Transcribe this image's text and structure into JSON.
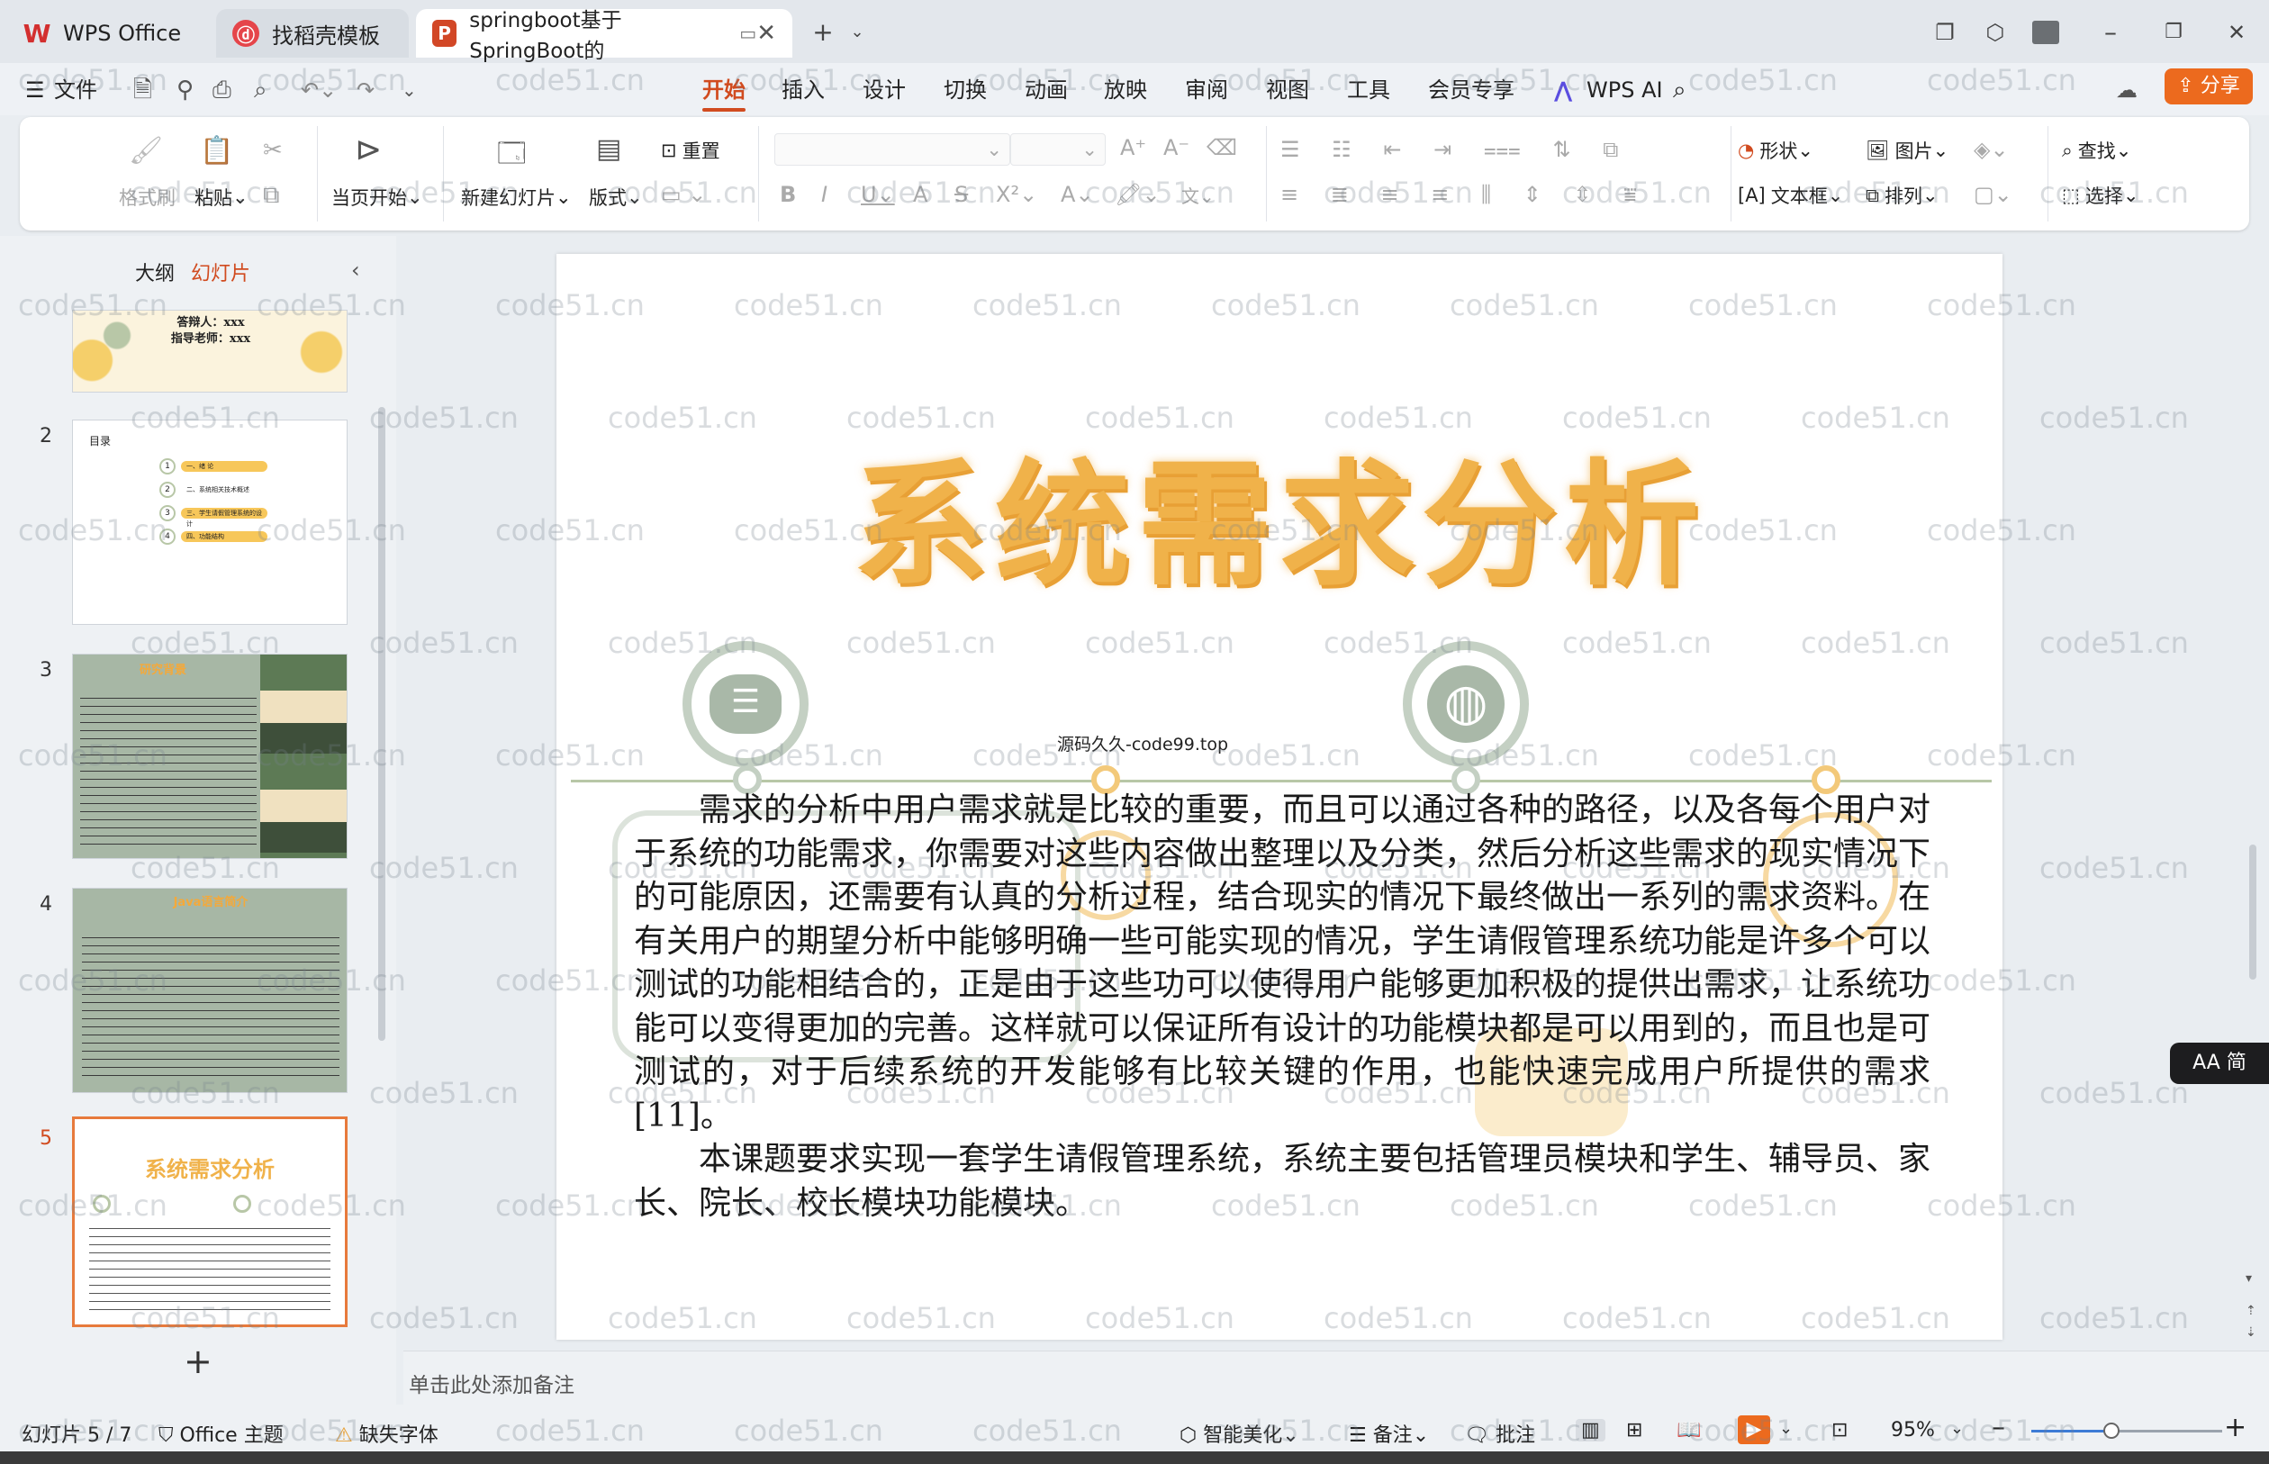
{
  "tabs": [
    {
      "label": "WPS Office",
      "icon": "wps-logo-icon"
    },
    {
      "label": "找稻壳模板",
      "icon": "docer-icon"
    },
    {
      "label": "springboot基于SpringBoot的",
      "icon": "ppt-file-icon"
    }
  ],
  "menu": {
    "file": "文件",
    "items": [
      "开始",
      "插入",
      "设计",
      "切换",
      "动画",
      "放映",
      "审阅",
      "视图",
      "工具",
      "会员专享"
    ],
    "wps_ai": "WPS AI",
    "share": "分享"
  },
  "ribbon": {
    "format_painter": "格式刷",
    "paste": "粘贴",
    "play_from_current": "当页开始",
    "new_slide": "新建幻灯片",
    "layout": "版式",
    "reset": "重置",
    "shape": "形状",
    "picture": "图片",
    "find": "查找",
    "textbox": "文本框",
    "arrange": "排列",
    "select": "选择"
  },
  "left_panel": {
    "tab_outline": "大纲",
    "tab_slides": "幻灯片",
    "slide_numbers": [
      "2",
      "3",
      "4",
      "5"
    ],
    "thumb1_lines": [
      "答辩人：xxx",
      "指导老师：xxx"
    ],
    "thumb2": {
      "title": "目录",
      "items": [
        "一、绪 论",
        "二、系统相关技术概述",
        "三、学生请假管理系统的设计",
        "四、功能结构"
      ]
    },
    "thumb3_title": "研究背景",
    "thumb4_title": "Java语言简介",
    "thumb5_title": "系统需求分析",
    "add": "+"
  },
  "slide": {
    "title": "系统需求分析",
    "caption": "源码久久-code99.top",
    "paragraph1": "需求的分析中用户需求就是比较的重要，而且可以通过各种的路径，以及各每个用户对于系统的功能需求，你需要对这些内容做出整理以及分类，然后分析这些需求的现实情况下的可能原因，还需要有认真的分析过程，结合现实的情况下最终做出一系列的需求资料。在有关用户的期望分析中能够明确一些可能实现的情况，学生请假管理系统功能是许多个可以测试的功能相结合的，正是由于这些功可以使得用户能够更加积极的提供出需求，让系统功能可以变得更加的完善。这样就可以保证所有设计的功能模块都是可以用到的，而且也是可测试的，对于后续系统的开发能够有比较关键的作用，也能快速完成用户所提供的需求[11]。",
    "paragraph2": "本课题要求实现一套学生请假管理系统，系统主要包括管理员模块和学生、辅导员、家长、院长、校长模块功能模块。"
  },
  "notes_placeholder": "单击此处添加备注",
  "status": {
    "slide_counter": "幻灯片 5 / 7",
    "theme": "Office 主题",
    "missing_fonts": "缺失字体",
    "beautify": "智能美化",
    "notes": "备注",
    "comments": "批注",
    "zoom": "95%"
  },
  "aa_button": "AA 简",
  "watermark": "code51.cn",
  "colors": {
    "accent": "#d14b1f",
    "share": "#ec6a1e",
    "title_gold": "#f0b24a",
    "selected_border": "#e77a3c"
  }
}
